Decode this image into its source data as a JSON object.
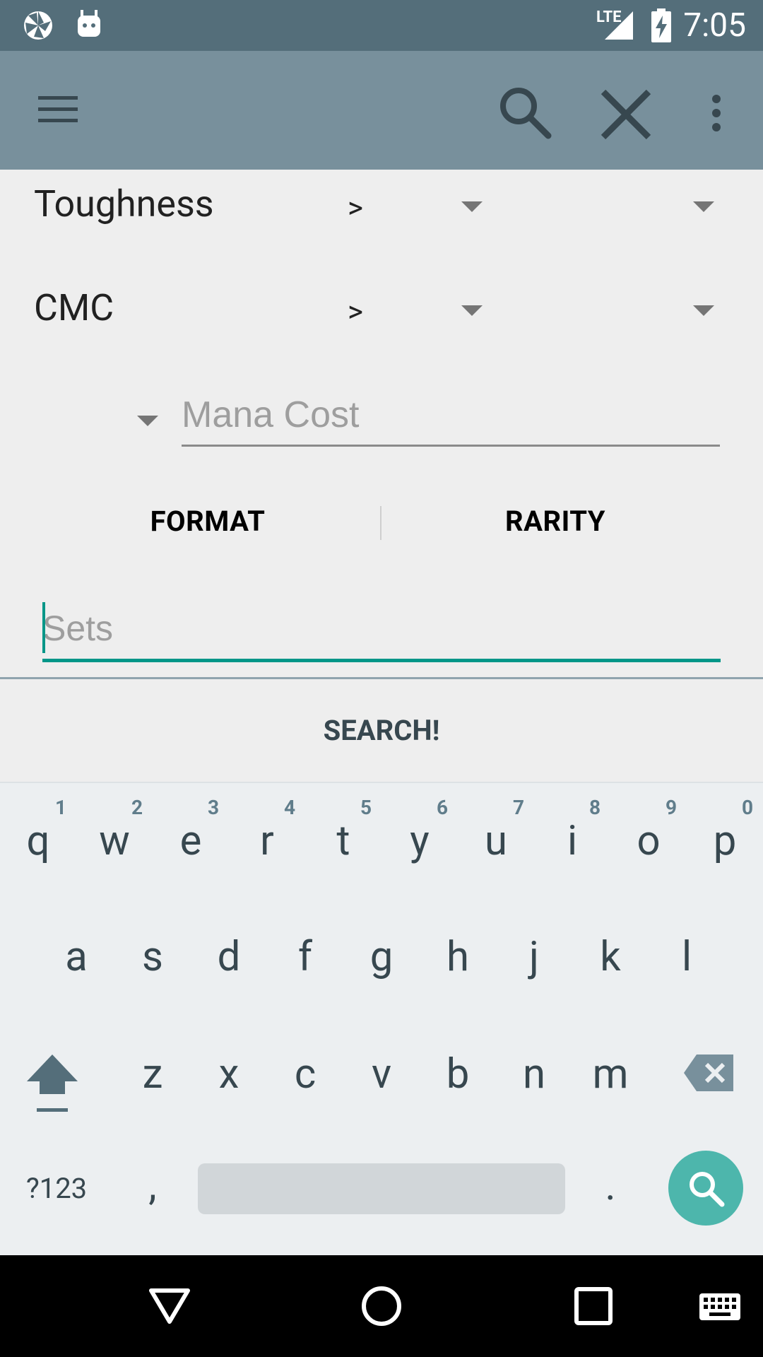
{
  "status_bar": {
    "time": "7:05",
    "network": "LTE",
    "icons": [
      "pinwheel-icon",
      "android-icon",
      "lte-signal-icon",
      "battery-charging-icon"
    ]
  },
  "toolbar": {
    "icons": [
      "menu-icon",
      "search-icon",
      "close-icon",
      "more-vert-icon"
    ]
  },
  "form": {
    "toughness": {
      "label": "Toughness",
      "operator": ">"
    },
    "cmc": {
      "label": "CMC",
      "operator": ">"
    },
    "mana_cost": {
      "placeholder": "Mana Cost",
      "value": ""
    },
    "format_label": "FORMAT",
    "rarity_label": "RARITY",
    "sets": {
      "placeholder": "Sets",
      "value": ""
    },
    "search_label": "SEARCH!"
  },
  "keyboard": {
    "row1": [
      "q",
      "w",
      "e",
      "r",
      "t",
      "y",
      "u",
      "i",
      "o",
      "p"
    ],
    "row1_hints": [
      "1",
      "2",
      "3",
      "4",
      "5",
      "6",
      "7",
      "8",
      "9",
      "0"
    ],
    "row2": [
      "a",
      "s",
      "d",
      "f",
      "g",
      "h",
      "j",
      "k",
      "l"
    ],
    "row3": [
      "z",
      "x",
      "c",
      "v",
      "b",
      "n",
      "m"
    ],
    "symbols_label": "?123",
    "comma": ",",
    "period": ".",
    "accent_color": "#4db6ac"
  },
  "nav_bar": {
    "icons": [
      "back-icon",
      "home-icon",
      "recents-icon",
      "keyboard-icon"
    ]
  }
}
